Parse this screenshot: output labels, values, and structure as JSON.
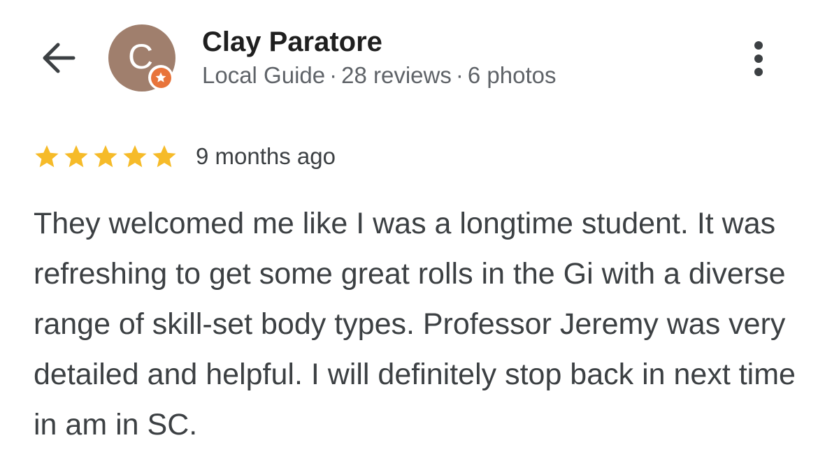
{
  "header": {
    "reviewer_name": "Clay Paratore",
    "avatar_letter": "C",
    "local_guide_label": "Local Guide",
    "reviews_count": "28 reviews",
    "photos_count": "6 photos",
    "separator": "·",
    "back_icon": "arrow-left-icon",
    "more_icon": "more-vertical-icon"
  },
  "review": {
    "rating": 5,
    "max_rating": 5,
    "time_ago": "9 months ago",
    "text": "They welcomed me like I was a longtime student. It was refreshing to get some great rolls in the Gi with a diverse range of skill-set body types. Professor Jeremy was very detailed and helpful. I will definitely stop back in next time in am in SC."
  },
  "colors": {
    "star": "#f6bb29",
    "avatar_bg": "#a07f6d",
    "badge": "#e8743b",
    "name": "#1f1f1f",
    "secondary_text": "#5f6368",
    "body_text": "#3c4043"
  }
}
